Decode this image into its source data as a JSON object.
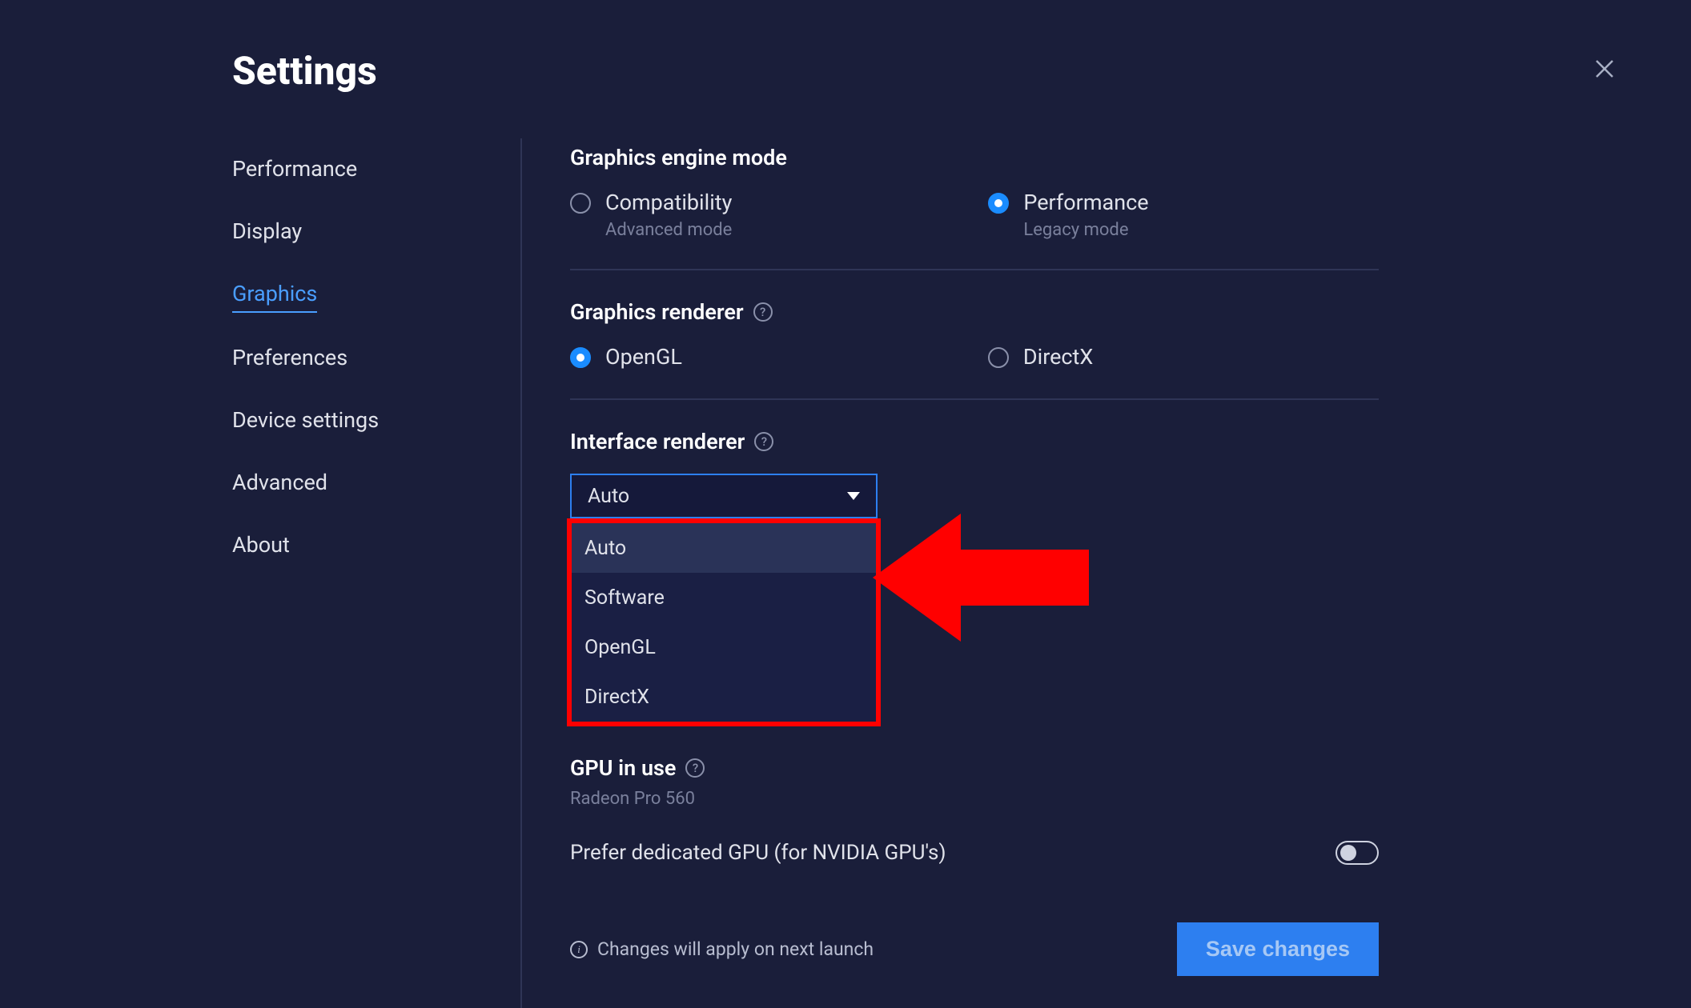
{
  "page_title": "Settings",
  "sidebar": {
    "items": [
      {
        "label": "Performance",
        "active": false
      },
      {
        "label": "Display",
        "active": false
      },
      {
        "label": "Graphics",
        "active": true
      },
      {
        "label": "Preferences",
        "active": false
      },
      {
        "label": "Device settings",
        "active": false
      },
      {
        "label": "Advanced",
        "active": false
      },
      {
        "label": "About",
        "active": false
      }
    ]
  },
  "sections": {
    "engine_mode": {
      "title": "Graphics engine mode",
      "options": [
        {
          "label": "Compatibility",
          "sublabel": "Advanced mode",
          "selected": false
        },
        {
          "label": "Performance",
          "sublabel": "Legacy mode",
          "selected": true
        }
      ]
    },
    "renderer": {
      "title": "Graphics renderer",
      "options": [
        {
          "label": "OpenGL",
          "selected": true
        },
        {
          "label": "DirectX",
          "selected": false
        }
      ]
    },
    "interface_renderer": {
      "title": "Interface renderer",
      "selected": "Auto",
      "options": [
        "Auto",
        "Software",
        "OpenGL",
        "DirectX"
      ],
      "highlighted_index": 0
    },
    "gpu": {
      "title": "GPU in use",
      "value": "Radeon Pro 560",
      "prefer_dedicated_label": "Prefer dedicated GPU (for NVIDIA GPU's)",
      "prefer_dedicated_on": false
    }
  },
  "footer": {
    "info_text": "Changes will apply on next launch",
    "save_button": "Save changes"
  },
  "icons": {
    "help": "?",
    "info": "i"
  },
  "annotation": {
    "arrow_color": "#ff0000"
  }
}
